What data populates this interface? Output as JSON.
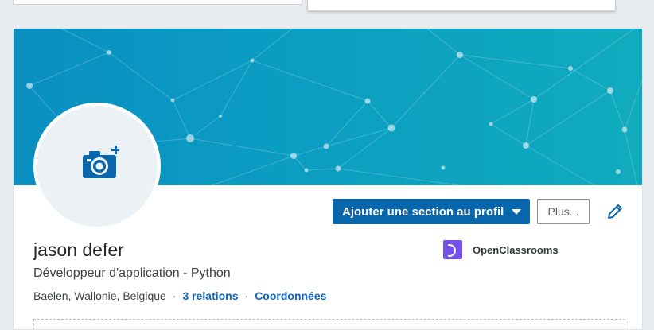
{
  "profile": {
    "name": "jason defer",
    "headline": "Développeur d'application - Python",
    "location": "Baelen, Wallonie, Belgique",
    "separator": "·",
    "relations_link": "3 relations",
    "contact_link": "Coordonnées"
  },
  "actions": {
    "add_section_label": "Ajouter une section au profil",
    "more_label": "Plus..."
  },
  "company": {
    "name": "OpenClassrooms",
    "logo_icon": "openclassrooms-logo-icon",
    "logo_color": "#7451eb"
  },
  "icons": {
    "avatar": "add-photo-camera-icon",
    "edit": "pencil-icon",
    "caret": "caret-down-icon"
  },
  "colors": {
    "primary": "#0a66ab",
    "link": "#0a66c2",
    "banner_start": "#0a8fc1",
    "banner_end": "#11abbe"
  }
}
